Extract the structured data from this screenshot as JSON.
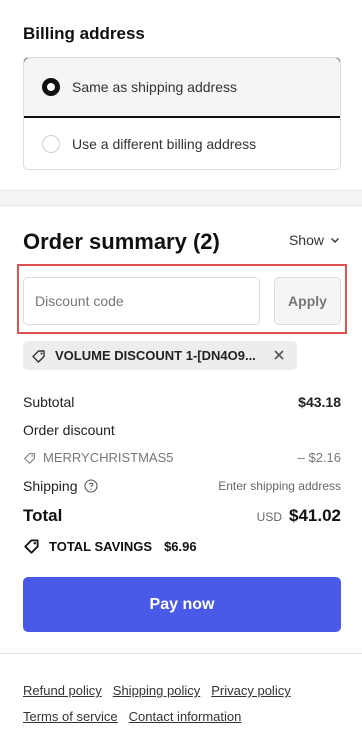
{
  "billing": {
    "title": "Billing address",
    "options": [
      {
        "label": "Same as shipping address",
        "selected": true
      },
      {
        "label": "Use a different billing address",
        "selected": false
      }
    ]
  },
  "summary": {
    "title": "Order summary (2)",
    "toggle_label": "Show"
  },
  "discount": {
    "placeholder": "Discount code",
    "value": "",
    "apply_label": "Apply",
    "applied_tag": "VOLUME DISCOUNT 1-[DN4O9..."
  },
  "totals": {
    "subtotal_label": "Subtotal",
    "subtotal_value": "$43.18",
    "order_discount_label": "Order discount",
    "discount_code": "MERRYCHRISTMAS5",
    "discount_value": "– $2.16",
    "shipping_label": "Shipping",
    "shipping_value": "Enter shipping address",
    "total_label": "Total",
    "currency": "USD",
    "total_value": "$41.02",
    "savings_label": "TOTAL SAVINGS",
    "savings_value": "$6.96"
  },
  "pay_button": "Pay now",
  "footer": {
    "links": [
      "Refund policy",
      "Shipping policy",
      "Privacy policy",
      "Terms of service",
      "Contact information"
    ]
  },
  "colors": {
    "accent": "#4a5ae8",
    "highlight": "#e05252"
  }
}
